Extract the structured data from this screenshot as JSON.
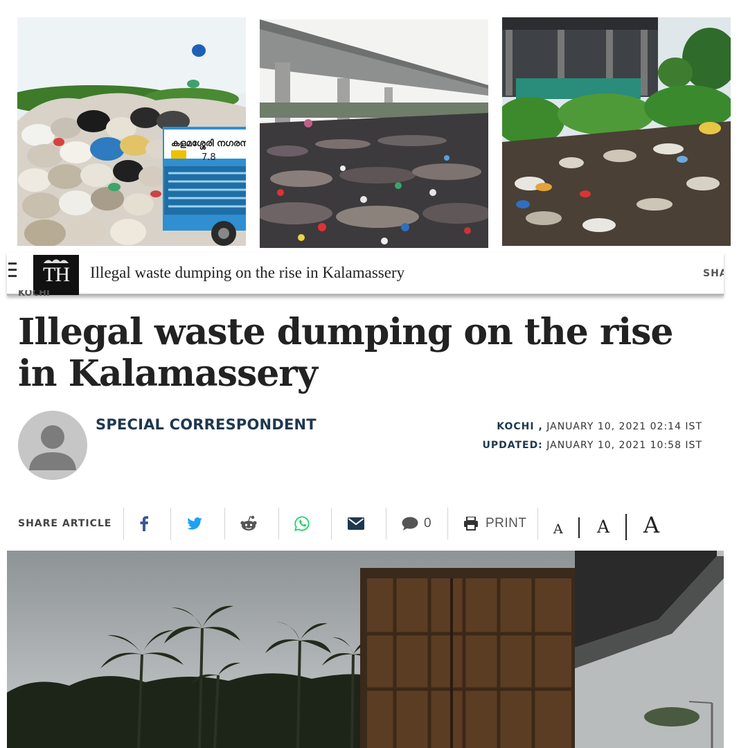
{
  "photos": [
    {
      "alt": "garbage-heap-with-municipal-truck",
      "truck_text": "കളമശ്ശേരി നഗരസഭ",
      "truck_number": "7.8"
    },
    {
      "alt": "plastic-waste-under-flyover"
    },
    {
      "alt": "roadside-litter-near-building"
    }
  ],
  "header": {
    "logo_text": "TH",
    "title": "Illegal waste dumping on the rise in Kalamassery",
    "share_label": "SHARE",
    "section_label": "KOCHI"
  },
  "article": {
    "headline": "Illegal waste dumping on the rise in Kalamassery",
    "author": "SPECIAL CORRESPONDENT",
    "location": "KOCHI ,",
    "published": "JANUARY 10, 2021 02:14 IST",
    "updated_label": "UPDATED:",
    "updated": "JANUARY 10, 2021 10:58 IST"
  },
  "share": {
    "label": "SHARE ARTICLE",
    "comment_count": "0",
    "print_label": "PRINT",
    "font_small": "A",
    "font_medium": "A",
    "font_large": "A",
    "icons": [
      "facebook-icon",
      "twitter-icon",
      "reddit-icon",
      "whatsapp-icon",
      "email-icon",
      "comment-icon",
      "print-icon"
    ]
  },
  "colors": {
    "facebook": "#3b5998",
    "twitter": "#1da1f2",
    "whatsapp": "#25d366",
    "email": "#1e3850",
    "author": "#1e3850"
  }
}
